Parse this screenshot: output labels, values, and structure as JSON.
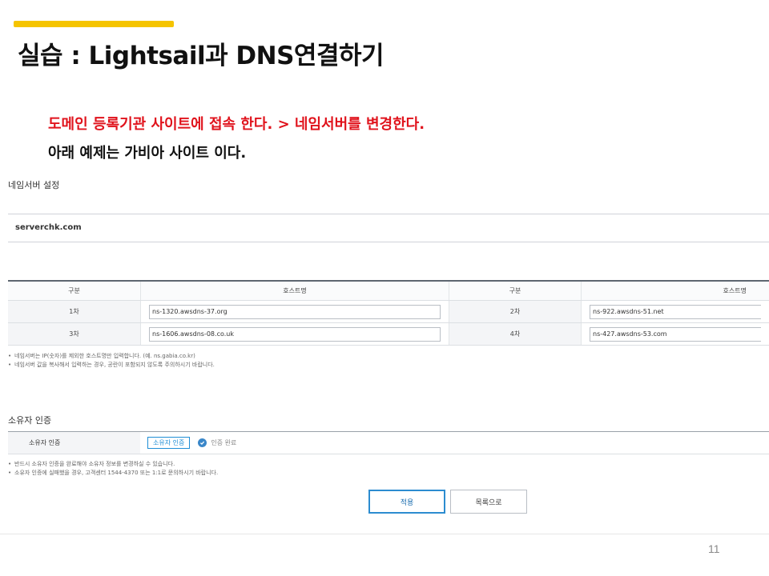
{
  "slide": {
    "title": "실습 : Lightsail과 DNS연결하기",
    "instruction_red": "도메인 등록기관 사이트에 접속 한다. > 네임서버를 변경한다.",
    "instruction_black": "아래 예제는 가비아 사이트 이다.",
    "page_number": "11",
    "accent_color": "#f5c400"
  },
  "nameserver": {
    "section_title": "네임서버 설정",
    "domain": "serverchk.com",
    "headers": {
      "col_type": "구분",
      "col_host": "호스트명"
    },
    "entries": [
      {
        "label": "1차",
        "value": "ns-1320.awsdns-37.org"
      },
      {
        "label": "2차",
        "value": "ns-922.awsdns-51.net"
      },
      {
        "label": "3차",
        "value": "ns-1606.awsdns-08.co.uk"
      },
      {
        "label": "4차",
        "value": "ns-427.awsdns-53.com"
      }
    ],
    "notes": [
      "네임서버는 IP(숫자)를 제외한 호스트명만 입력합니다. (예. ns.gabia.co.kr)",
      "네임서버 값을 복사해서 입력하는 경우, 공란이 포함되지 않도록 주의하시기 바랍니다."
    ]
  },
  "owner": {
    "section_title": "소유자 인증",
    "row_label": "소유자 인증",
    "verify_button": "소유자 인증",
    "status_text": "인증 완료",
    "status_color": "#3a87c9",
    "notes": [
      "반드시 소유자 인증을 완료해야 소유자 정보를 변경하실 수 있습니다.",
      "소유자 인증에 실패했을 경우, 고객센터 1544-4370 또는 1:1로 문의하시기 바랍니다."
    ]
  },
  "buttons": {
    "apply": "적용",
    "list": "목록으로"
  }
}
